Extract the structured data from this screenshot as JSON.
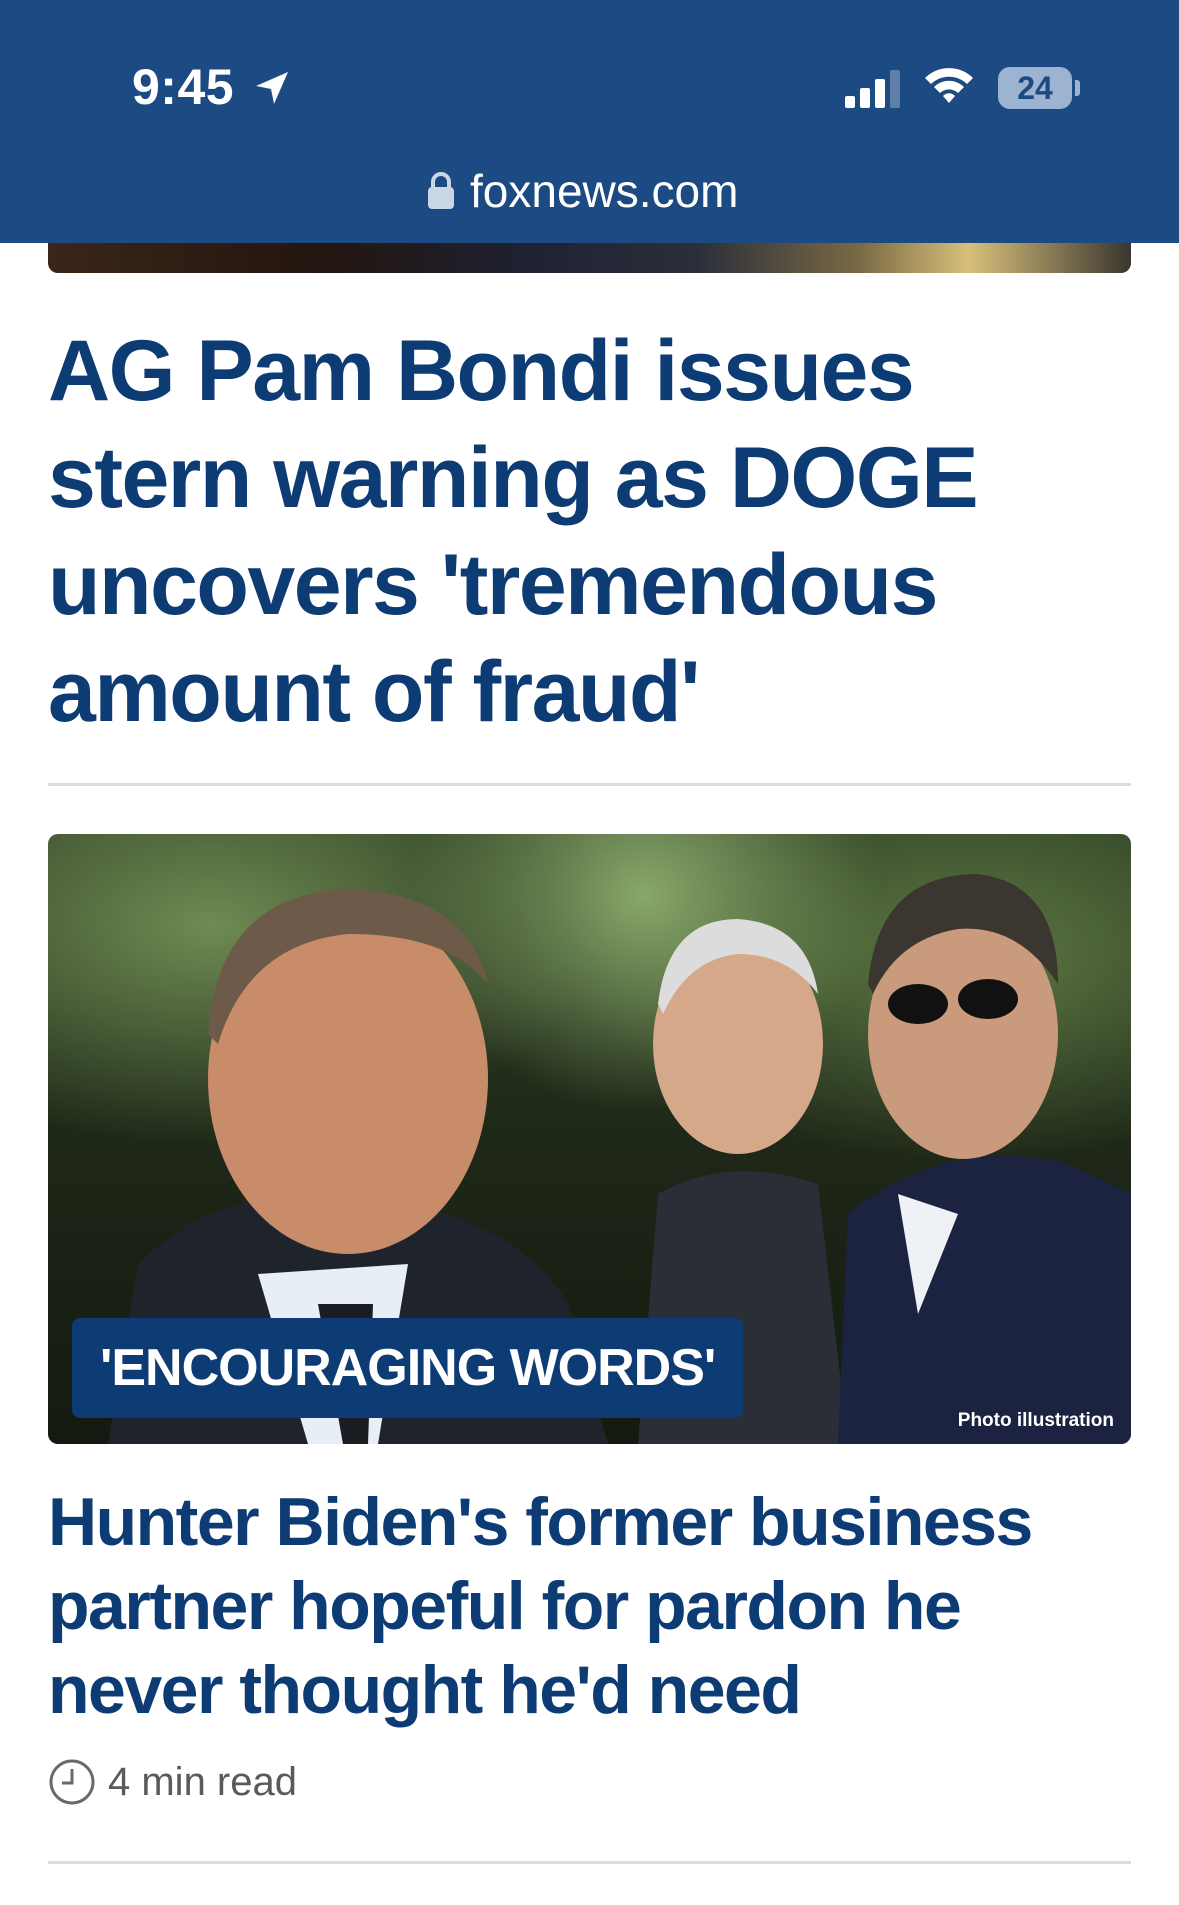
{
  "status_bar": {
    "time": "9:45",
    "battery_level": "24",
    "icons": [
      "location-arrow-icon",
      "cellular-signal-icon",
      "wifi-icon",
      "battery-icon"
    ]
  },
  "address_bar": {
    "url": "foxnews.com",
    "icon": "lock-icon"
  },
  "colors": {
    "header_bg": "#1c4a83",
    "headline": "#0d3b73",
    "kicker_bg": "#0d3b73",
    "meta_text": "#5a5a5a"
  },
  "articles": [
    {
      "headline": "AG Pam Bondi issues stern warning as DOGE uncovers 'tremendous amount of fraud'"
    },
    {
      "kicker": "'ENCOURAGING WORDS'",
      "photo_credit": "Photo illustration",
      "headline": "Hunter Biden's former business partner hopeful for pardon he never thought he'd need",
      "read_time": "4 min read",
      "read_time_icon": "clock-icon"
    }
  ]
}
